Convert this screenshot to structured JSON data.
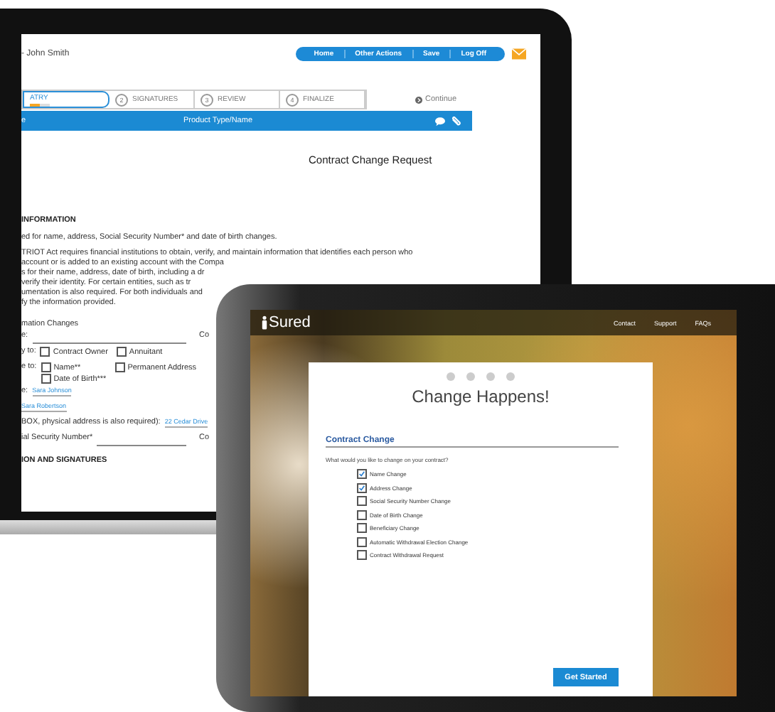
{
  "laptop": {
    "user": "- John Smith",
    "nav": [
      "Home",
      "Other Actions",
      "Save",
      "Log Off"
    ],
    "steps": [
      {
        "label": "ATRY",
        "selected": true,
        "level": 0.5
      },
      {
        "number": "2",
        "label": "SIGNATURES",
        "selected": false
      },
      {
        "number": "3",
        "label": "REVIEW",
        "selected": false
      },
      {
        "number": "4",
        "label": "FINALIZE",
        "selected": false
      }
    ],
    "continue": "Continue",
    "bar": {
      "left": "e",
      "title": "Product Type/Name"
    },
    "form_title": "Contract Change Request",
    "section": "INFORMATION",
    "note": "ed for name, address, Social Security Number* and date of birth changes.",
    "paragraph": [
      "TRIOT Act requires financial institutions to obtain, verify, and maintain information that identifies each person who",
      "account or is added to an existing account with the Compa",
      "s for their name, address, date of birth, including a dr",
      "verify their identity. For certain entities, such as tr",
      "umentation is also required. For both individuals and",
      "fy the information provided."
    ],
    "subsection": "mation Changes",
    "rows": [
      {
        "kind": "field",
        "label": "e:",
        "after": "Co"
      },
      {
        "kind": "checks",
        "label": "y to:",
        "options": [
          {
            "label": "Contract Owner",
            "checked": false
          },
          {
            "label": "Annuitant",
            "checked": false
          }
        ]
      },
      {
        "kind": "checks",
        "label": "e to:",
        "options": [
          {
            "label": "Name**",
            "checked": false
          },
          {
            "label": "Permanent Address",
            "checked": false
          },
          {
            "label": "Date of Birth***",
            "checked": false
          }
        ]
      },
      {
        "kind": "link",
        "label": "e:",
        "value": "Sara Johnson"
      },
      {
        "kind": "link",
        "label": "",
        "value": "Sara Robertson"
      },
      {
        "kind": "link",
        "label": "BOX, physical address is also required):",
        "value": "22 Cedar Drive"
      },
      {
        "kind": "field",
        "label": "ial Security Number*",
        "after": "Co"
      }
    ],
    "last_section": "ION AND SIGNATURES"
  },
  "tablet": {
    "logo": "Sured",
    "nav": [
      "Contact",
      "Support",
      "FAQs"
    ],
    "title": "Change Happens!",
    "heading": "Contract Change",
    "question": "What would you like to change on your contract?",
    "options": [
      {
        "label": "Name Change",
        "checked": true
      },
      {
        "label": "Address Change",
        "checked": true
      },
      {
        "label": "Social Security Number Change",
        "checked": false
      },
      {
        "label": "Date of Birth Change",
        "checked": false
      },
      {
        "label": "Beneficiary Change",
        "checked": false
      },
      {
        "label": "Automatic Withdrawal Election Change",
        "checked": false
      },
      {
        "label": "Contract Withdrawal Request",
        "checked": false
      }
    ],
    "button": "Get Started"
  }
}
